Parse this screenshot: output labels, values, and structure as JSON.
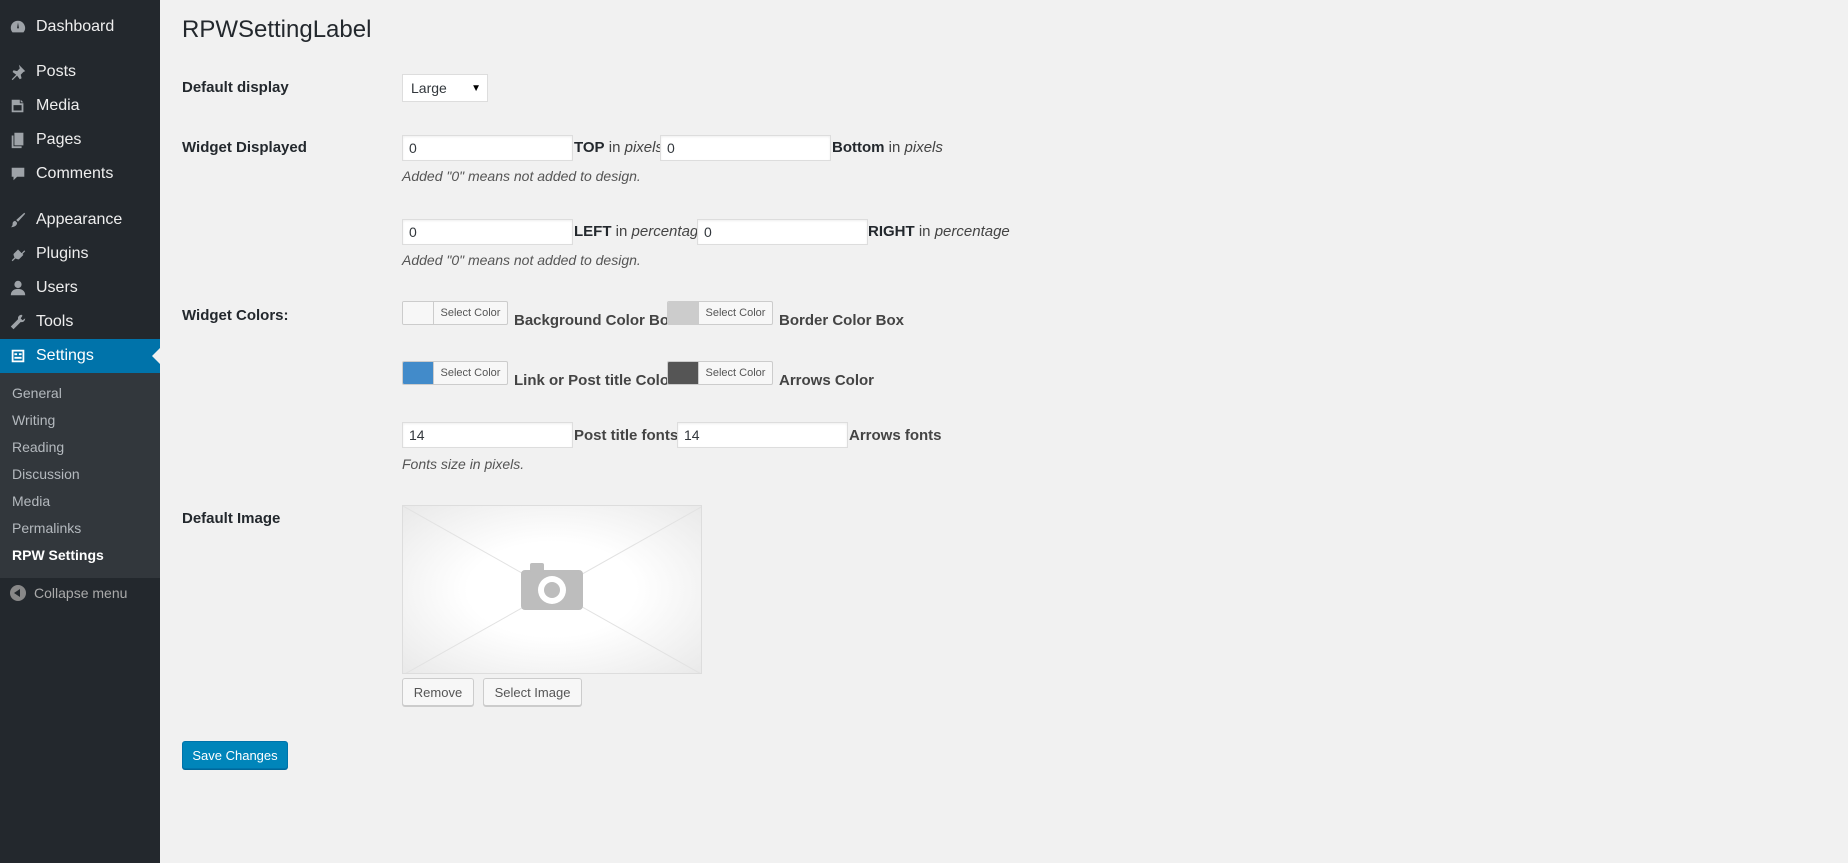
{
  "sidebar": {
    "items": [
      {
        "label": "Dashboard",
        "icon": "dashboard-icon"
      },
      {
        "label": "Posts",
        "icon": "pin-icon"
      },
      {
        "label": "Media",
        "icon": "media-icon"
      },
      {
        "label": "Pages",
        "icon": "pages-icon"
      },
      {
        "label": "Comments",
        "icon": "comment-icon"
      },
      {
        "label": "Appearance",
        "icon": "brush-icon"
      },
      {
        "label": "Plugins",
        "icon": "plug-icon"
      },
      {
        "label": "Users",
        "icon": "user-icon"
      },
      {
        "label": "Tools",
        "icon": "wrench-icon"
      },
      {
        "label": "Settings",
        "icon": "settings-icon"
      }
    ],
    "submenu": [
      "General",
      "Writing",
      "Reading",
      "Discussion",
      "Media",
      "Permalinks",
      "RPW Settings"
    ],
    "collapse_label": "Collapse menu",
    "active_color": "#0073aa"
  },
  "page": {
    "title": "RPWSettingLabel",
    "default_display": {
      "label": "Default display",
      "value": "Large"
    },
    "widget_displayed": {
      "label": "Widget Displayed",
      "top_value": "0",
      "top_text": "TOP",
      "top_unit": "pixels",
      "bottom_value": "0",
      "bottom_text": "Bottom",
      "bottom_unit": "pixels",
      "note1": "Added \"0\" means not added to design.",
      "left_value": "0",
      "left_text": "LEFT",
      "left_unit": "percentage",
      "right_value": "0",
      "right_text": "RIGHT",
      "right_unit": "percentage",
      "note2": "Added \"0\" means not added to design.",
      "in_word": "in"
    },
    "widget_colors": {
      "label": "Widget Colors:",
      "select_color_label": "Select Color",
      "background": {
        "label": "Background Color Box",
        "color": "#f7f7f7"
      },
      "border": {
        "label": "Border Color Box",
        "color": "#cccccc"
      },
      "link": {
        "label": "Link or Post title Color",
        "color": "#428bca"
      },
      "arrows": {
        "label": "Arrows Color",
        "color": "#555555"
      }
    },
    "fonts": {
      "post_title_value": "14",
      "post_title_label": "Post title fonts",
      "arrows_value": "14",
      "arrows_label": "Arrows fonts",
      "note": "Fonts size in pixels."
    },
    "default_image": {
      "label": "Default Image",
      "remove_label": "Remove",
      "select_label": "Select Image"
    },
    "save_label": "Save Changes"
  }
}
